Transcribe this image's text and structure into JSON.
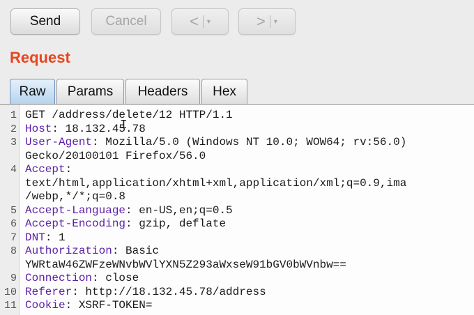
{
  "toolbar": {
    "send_label": "Send",
    "cancel_label": "Cancel",
    "back_glyph": "<",
    "forward_glyph": ">",
    "dropdown_glyph": "▾"
  },
  "request_title": "Request",
  "tabs": [
    {
      "label": "Raw",
      "active": true
    },
    {
      "label": "Params",
      "active": false
    },
    {
      "label": "Headers",
      "active": false
    },
    {
      "label": "Hex",
      "active": false
    }
  ],
  "colors": {
    "title": "#e8461e",
    "header_key": "#5b1fa6",
    "active_tab": "#b6d3ee"
  },
  "editor": {
    "lines": [
      {
        "num": "1",
        "key": "",
        "text": "GET /address/delete/12 HTTP/1.1"
      },
      {
        "num": "2",
        "key": "Host",
        "text": ": 18.132.45.78"
      },
      {
        "num": "3",
        "key": "User-Agent",
        "text": ": Mozilla/5.0 (Windows NT 10.0; WOW64; rv:56.0)"
      },
      {
        "num": "",
        "key": "",
        "text": "Gecko/20100101 Firefox/56.0"
      },
      {
        "num": "4",
        "key": "Accept",
        "text": ":"
      },
      {
        "num": "",
        "key": "",
        "text": "text/html,application/xhtml+xml,application/xml;q=0.9,ima"
      },
      {
        "num": "",
        "key": "",
        "text": "/webp,*/*;q=0.8"
      },
      {
        "num": "5",
        "key": "Accept-Language",
        "text": ": en-US,en;q=0.5"
      },
      {
        "num": "6",
        "key": "Accept-Encoding",
        "text": ": gzip, deflate"
      },
      {
        "num": "7",
        "key": "DNT",
        "text": ": 1"
      },
      {
        "num": "8",
        "key": "Authorization",
        "text": ": Basic"
      },
      {
        "num": "",
        "key": "",
        "text": "YWRtaW46ZWFzeWNvbWVlYXN5Z293aWxseW91bGV0bWVnbw=="
      },
      {
        "num": "9",
        "key": "Connection",
        "text": ": close"
      },
      {
        "num": "10",
        "key": "Referer",
        "text": ": http://18.132.45.78/address"
      },
      {
        "num": "11",
        "key": "Cookie",
        "text": ": XSRF-TOKEN="
      }
    ]
  }
}
